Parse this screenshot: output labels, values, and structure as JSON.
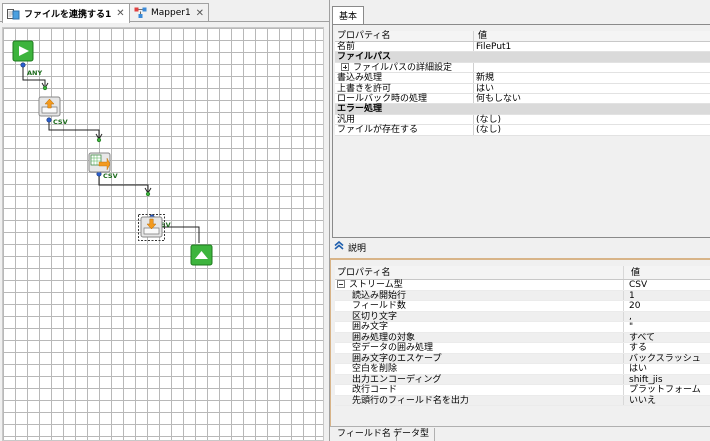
{
  "editor_tabs": [
    {
      "label": "ファイルを連携する1",
      "close": "✕"
    },
    {
      "label": "Mapper1",
      "close": "✕"
    }
  ],
  "flow": {
    "port_labels": [
      "ANY",
      "CSV",
      "CSV",
      "CSV"
    ]
  },
  "properties_tab": "基本",
  "property_table": {
    "header_name": "プロパティ名",
    "header_value": "値",
    "rows": [
      {
        "name": "名前",
        "value": "FilePut1",
        "type": "normal"
      },
      {
        "name": "ファイルパス",
        "value": "",
        "type": "category"
      },
      {
        "name": "ファイルパスの詳細設定",
        "value": "",
        "type": "expand"
      },
      {
        "name": "書込み処理",
        "value": "新規",
        "type": "normal"
      },
      {
        "name": "上書きを許可",
        "value": "はい",
        "type": "normal"
      },
      {
        "name": "ロールバック時の処理",
        "value": "何もしない",
        "type": "normal"
      },
      {
        "name": "エラー処理",
        "value": "",
        "type": "category"
      },
      {
        "name": "汎用",
        "value": "(なし)",
        "type": "normal"
      },
      {
        "name": "ファイルが存在する",
        "value": "(なし)",
        "type": "normal"
      }
    ]
  },
  "description_label": "説明",
  "stream_table": {
    "header_name": "プロパティ名",
    "header_value": "値",
    "rows": [
      {
        "name": "ストリーム型",
        "value": "CSV",
        "indent": 0,
        "expander": true
      },
      {
        "name": "読込み開始行",
        "value": "1",
        "indent": 1
      },
      {
        "name": "フィールド数",
        "value": "20",
        "indent": 1
      },
      {
        "name": "区切り文字",
        "value": ",",
        "indent": 1
      },
      {
        "name": "囲み文字",
        "value": "\"",
        "indent": 1
      },
      {
        "name": "囲み処理の対象",
        "value": "すべて",
        "indent": 1
      },
      {
        "name": "空データの囲み処理",
        "value": "する",
        "indent": 1
      },
      {
        "name": "囲み文字のエスケープ",
        "value": "バックスラッシュ",
        "indent": 1
      },
      {
        "name": "空白を削除",
        "value": "はい",
        "indent": 1
      },
      {
        "name": "出力エンコーディング",
        "value": "shift_jis",
        "indent": 1
      },
      {
        "name": "改行コード",
        "value": "プラットフォーム",
        "indent": 1
      },
      {
        "name": "先頭行のフィールド名を出力",
        "value": "いいえ",
        "indent": 1
      }
    ]
  },
  "field_tabs": [
    "フィールド名",
    "データ型"
  ],
  "colors": {
    "start_green": "#3db43d",
    "connector": "#222222",
    "port_blue": "#2a5fd0",
    "category_bg": "#dadada",
    "panel_border_orange": "#d8b488"
  }
}
